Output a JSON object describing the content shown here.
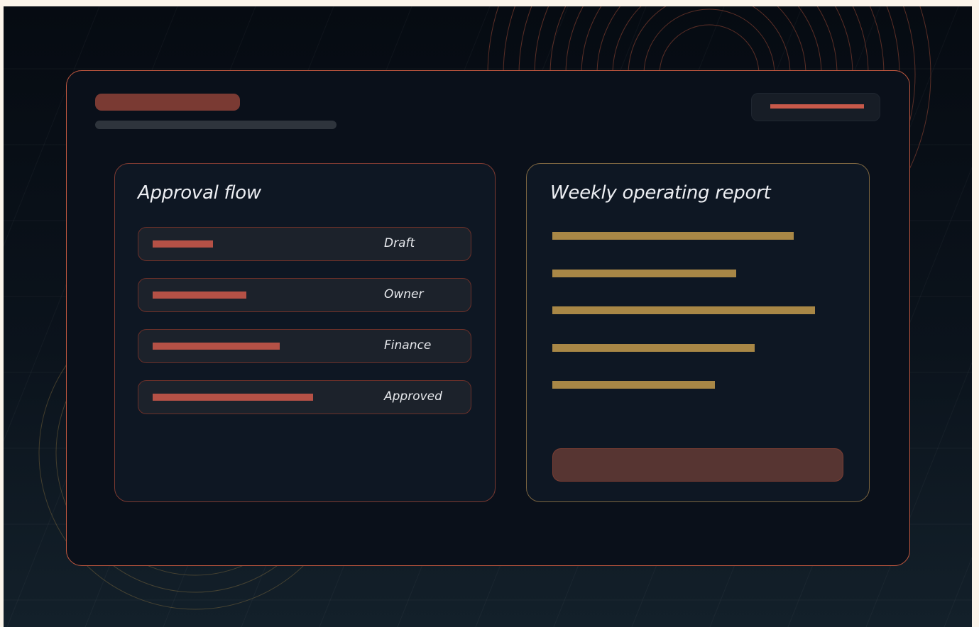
{
  "theme": {
    "accent": "#c2583f",
    "secondary_accent": "#a88746",
    "background": "#0a101a",
    "text": "#eceef2"
  },
  "approval_flow": {
    "title": "Approval flow",
    "steps": [
      {
        "label": "Draft",
        "progress": 0.18
      },
      {
        "label": "Owner",
        "progress": 0.28
      },
      {
        "label": "Finance",
        "progress": 0.38
      },
      {
        "label": "Approved",
        "progress": 0.48
      }
    ]
  },
  "weekly_report": {
    "title": "Weekly operating report",
    "bars": [
      0.92,
      0.7,
      1.0,
      0.77,
      0.62
    ]
  }
}
